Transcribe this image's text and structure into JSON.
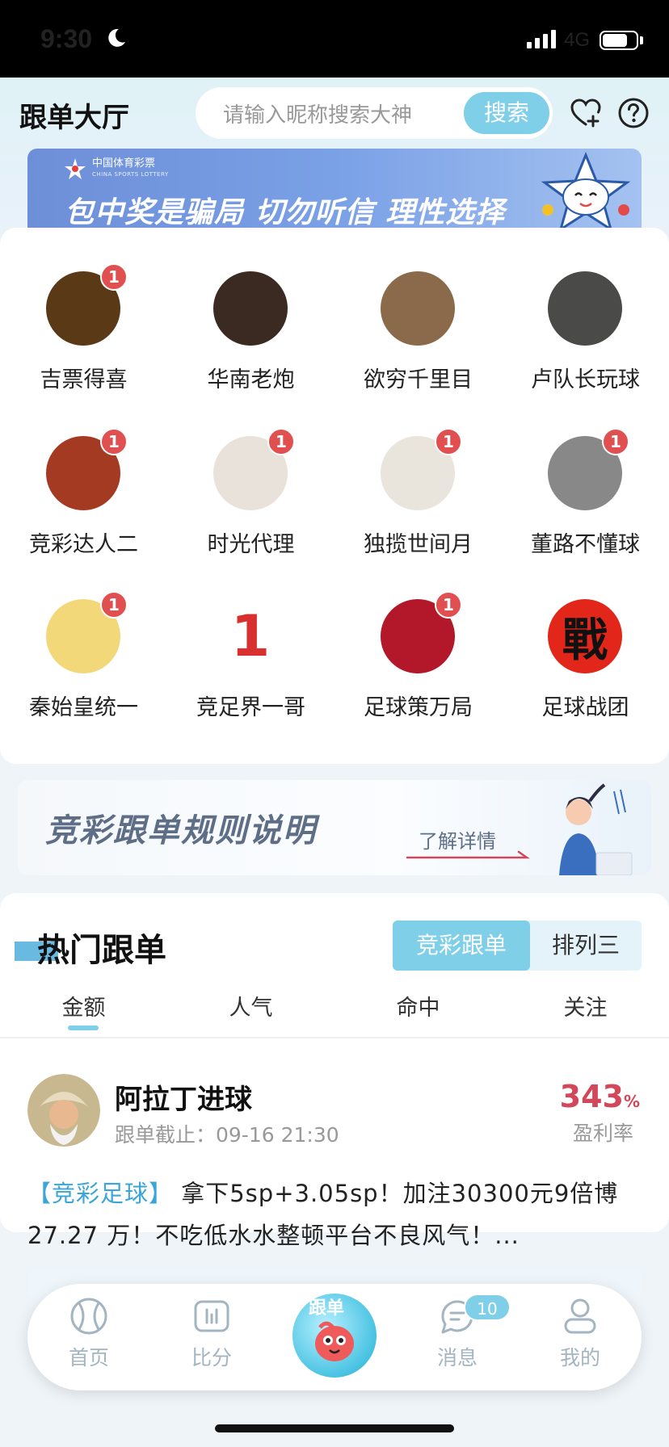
{
  "status_bar": {
    "time": "9:30",
    "network": "4G",
    "battery_level": 0.75
  },
  "header": {
    "title": "跟单大厅",
    "search_placeholder": "请输入昵称搜索大神",
    "search_button": "搜索",
    "icons": [
      "heart-plus-icon",
      "help-icon"
    ]
  },
  "banner": {
    "logo_text": "中国体育彩票",
    "logo_en": "CHINA SPORTS LOTTERY",
    "slogan": "包中奖是骗局 切勿听信 理性选择"
  },
  "experts": [
    {
      "name": "吉票得喜",
      "badge": "1",
      "avatar_color": "#5a3a16"
    },
    {
      "name": "华南老炮",
      "badge": "",
      "avatar_color": "#3b2a22"
    },
    {
      "name": "欲穷千里目",
      "badge": "",
      "avatar_color": "#8a6a4a"
    },
    {
      "name": "卢队长玩球",
      "badge": "",
      "avatar_color": "#4a4a48"
    },
    {
      "name": "竞彩达人二",
      "badge": "1",
      "avatar_color": "#a53a22"
    },
    {
      "name": "时光代理",
      "badge": "1",
      "avatar_color": "#e8e2da"
    },
    {
      "name": "独揽世间月",
      "badge": "1",
      "avatar_color": "#e9e4dc"
    },
    {
      "name": "董路不懂球",
      "badge": "1",
      "avatar_color": "#888888"
    },
    {
      "name": "秦始皇统一",
      "badge": "1",
      "avatar_color": "#f3d87a"
    },
    {
      "name": "竞足界一哥",
      "badge": "",
      "avatar_color": "#ffffff",
      "avatar_glyph": "1"
    },
    {
      "name": "足球策万局",
      "badge": "1",
      "avatar_color": "#b3182a"
    },
    {
      "name": "足球战团",
      "badge": "",
      "avatar_color": "#e2271a",
      "avatar_glyph": "戰"
    }
  ],
  "rules_banner": {
    "title": "竞彩跟单规则说明",
    "link": "了解详情"
  },
  "hot": {
    "title": "热门跟单",
    "segments": [
      "竞彩跟单",
      "排列三"
    ],
    "active_segment": 0,
    "tabs": [
      "金额",
      "人气",
      "命中",
      "关注"
    ],
    "active_tab": 0
  },
  "post": {
    "name": "阿拉丁进球",
    "deadline_label": "跟单截止：",
    "deadline": "09-16 21:30",
    "rate_value": "343",
    "rate_unit": "%",
    "rate_label": "盈利率",
    "tag": "【竞彩足球】",
    "body": " 拿下5sp+3.05sp！加注30300元9倍博27.27 万！不吃低水水整顿平台不良风气！..."
  },
  "nav": {
    "items": [
      "首页",
      "比分",
      "跟单",
      "消息",
      "我的"
    ],
    "message_badge": "10"
  }
}
